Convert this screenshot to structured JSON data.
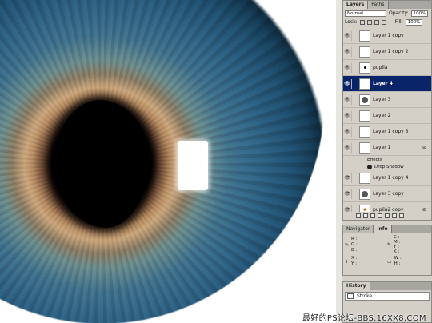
{
  "layers_panel": {
    "tabs": [
      {
        "label": "Layers",
        "active": true
      },
      {
        "label": "Paths",
        "active": false
      }
    ],
    "blend_mode": "Normal",
    "opacity_label": "Opacity:",
    "opacity_value": "100%",
    "lock_label": "Lock:",
    "fill_label": "Fill:",
    "fill_value": "100%",
    "layers": [
      {
        "name": "Layer 1 copy",
        "thumb": "blank",
        "selected": false,
        "fx": false
      },
      {
        "name": "Layer 1 copy 2",
        "thumb": "blank",
        "selected": false,
        "fx": false
      },
      {
        "name": "pupila",
        "thumb": "dot",
        "selected": false,
        "fx": false
      },
      {
        "name": "Layer 4",
        "thumb": "blank",
        "selected": true,
        "fx": false
      },
      {
        "name": "Layer 3",
        "thumb": "gear",
        "selected": false,
        "fx": false
      },
      {
        "name": "Layer 2",
        "thumb": "blank",
        "selected": false,
        "fx": false
      },
      {
        "name": "Layer 1 copy 3",
        "thumb": "blank",
        "selected": false,
        "fx": false
      },
      {
        "name": "Layer 1",
        "thumb": "blank",
        "selected": false,
        "fx": true
      }
    ],
    "effects_label": "Effects",
    "effect_item": "Drop Shadow",
    "layers_after": [
      {
        "name": "Layer 1 copy 4",
        "thumb": "blank",
        "selected": false,
        "fx": false
      },
      {
        "name": "Layer 3 copy",
        "thumb": "gear",
        "selected": false,
        "fx": false
      },
      {
        "name": "pupila2 copy",
        "thumb": "plus",
        "selected": false,
        "fx": true
      }
    ]
  },
  "navigator_panel": {
    "tabs": [
      {
        "label": "Navigator",
        "active": false
      },
      {
        "label": "Info",
        "active": true
      }
    ],
    "info": {
      "r": "R :",
      "g": "G :",
      "b": "B :",
      "c": "C :",
      "m": "M :",
      "y": "Y :",
      "k": "K :",
      "x": "X :",
      "y_coord": "Y :",
      "w": "W :",
      "h": "H :"
    }
  },
  "history_panel": {
    "tabs": [
      {
        "label": "History",
        "active": true
      }
    ],
    "items": [
      "Stroke"
    ]
  },
  "watermark": "最好的PS论坛-BBS.16XX8.COM"
}
